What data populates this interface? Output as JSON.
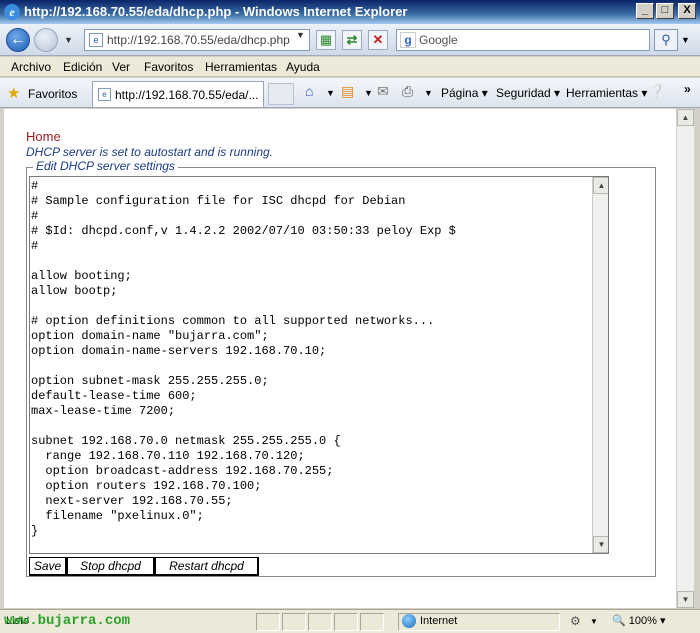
{
  "window": {
    "title": "http://192.168.70.55/eda/dhcp.php - Windows Internet Explorer",
    "minimize": "_",
    "maximize": "□",
    "close": "X"
  },
  "address_bar": {
    "url": "http://192.168.70.55/eda/dhcp.php",
    "search_placeholder": "Google"
  },
  "menu": {
    "items": [
      "Archivo",
      "Edición",
      "Ver",
      "Favoritos",
      "Herramientas",
      "Ayuda"
    ]
  },
  "favorites_bar": {
    "favorites_label": "Favoritos",
    "tab_title": "http://192.168.70.55/eda/...",
    "commands": [
      "Página",
      "Seguridad",
      "Herramientas"
    ]
  },
  "page": {
    "home_link": "Home",
    "status_message": "DHCP server is set to autostart and is running.",
    "legend": "Edit DHCP server settings",
    "config_text": "#\n# Sample configuration file for ISC dhcpd for Debian\n#\n# $Id: dhcpd.conf,v 1.4.2.2 2002/07/10 03:50:33 peloy Exp $\n#\n\nallow booting;\nallow bootp;\n\n# option definitions common to all supported networks...\noption domain-name \"bujarra.com\";\noption domain-name-servers 192.168.70.10;\n\noption subnet-mask 255.255.255.0;\ndefault-lease-time 600;\nmax-lease-time 7200;\n\nsubnet 192.168.70.0 netmask 255.255.255.0 {\n  range 192.168.70.110 192.168.70.120;\n  option broadcast-address 192.168.70.255;\n  option routers 192.168.70.100;\n  next-server 192.168.70.55;\n  filename \"pxelinux.0\";\n}",
    "buttons": {
      "save": "Save",
      "stop": "Stop dhcpd",
      "restart": "Restart dhcpd"
    }
  },
  "status_bar": {
    "text": "Listo",
    "zone": "Internet",
    "zoom": "100%"
  },
  "watermark": "www.bujarra.com",
  "colors": {
    "home_link": "#9c1c1c",
    "status_message": "#1a3a8a",
    "watermark": "#2aa22a"
  }
}
